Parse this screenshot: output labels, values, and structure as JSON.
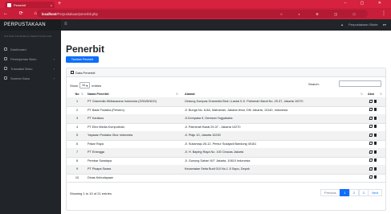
{
  "browser": {
    "tab_title": "Penerbit",
    "tab_close": "×",
    "new_tab": "+",
    "window_controls": "– ▢ ✕",
    "nav_buttons": "← ⟳ ⌂",
    "url_host": "localhost",
    "url_path": "/Perpustakaan/penerbit.php",
    "toolbar_icons": "☆ ◐ ⚙ ◫ ⬡",
    "menu_dots": "⋮"
  },
  "app": {
    "brand": "PERPUSTAKAAN",
    "toggle_icon": "≡",
    "user_label": "Perpustakaan Stiwle",
    "bell": "🔔"
  },
  "sidebar": {
    "heading": "SISTEM INFORMASI PERPUSTAKAAN",
    "items": [
      {
        "label": "Dashboard",
        "chevron": ""
      },
      {
        "label": "Peminjaman Buku",
        "chevron": "›"
      },
      {
        "label": "Transaksi Buku",
        "chevron": "›"
      },
      {
        "label": "Sumber Buku",
        "chevron": "›"
      }
    ]
  },
  "main": {
    "title": "Penerbit",
    "add_button": "Tambah Penerbit",
    "card_title": "Data Penerbit",
    "show_label": "Show",
    "show_value": "10",
    "entries_label": "entries",
    "search_label": "Search:",
    "search_value": "",
    "columns": {
      "no": "No",
      "name": "Nama Penerbit",
      "address": "Alamat",
      "action": "Aksi"
    },
    "rows": [
      {
        "no": "1",
        "name": "PT Gramedia Widiasarana Indonesia (GRASINDO)",
        "address": "Gedung Kompas Gramedia Blok I,Lantai 5 Jl. Palmerah Barat No. 29-37, Jakarta 10270"
      },
      {
        "no": "2",
        "name": "PT Balai Pustaka (Persero)",
        "address": "Jl. Bunga No. 8-8A, Matraman, Jakarta timur, DKI Jakarta, 13140, Indonesia"
      },
      {
        "no": "3",
        "name": "PT Kanisius",
        "address": "Jl.Cempaka 9, Deresan Yogyakarta"
      },
      {
        "no": "4",
        "name": "PT Elex Media Komputindo",
        "address": "Jl. Palmerah Barat 29-37 - Jakarta 10270"
      },
      {
        "no": "5",
        "name": "Yayasan Pustaka Obor Indonesia",
        "address": "Jl. Plaju 10, Jakarta 10230"
      },
      {
        "no": "6",
        "name": "Pakar Raya",
        "address": "Jl. Sukamaju 26-12, Perkur Sukajadi Bandung 40161"
      },
      {
        "no": "7",
        "name": "PT Erlangga",
        "address": "Jl. H. Baping Raya No. 100 Ciracas Jakarta"
      },
      {
        "no": "8",
        "name": "Pembar Swadaya",
        "address": "Jl. Gunung Sahari III/7 Jakarta, 10610 Indonesia"
      },
      {
        "no": "9",
        "name": "PT Pisapa Swara",
        "address": "Kecamatan Setia Budi 010 No.1 Jl Sapu, Depok"
      },
      {
        "no": "10",
        "name": "Dinas Kebudayaan",
        "address": ""
      }
    ],
    "footer_info": "Showing 1 to 10 of 21 entries",
    "pagination": [
      "Previous",
      "1",
      "2",
      "3",
      "Next"
    ]
  }
}
